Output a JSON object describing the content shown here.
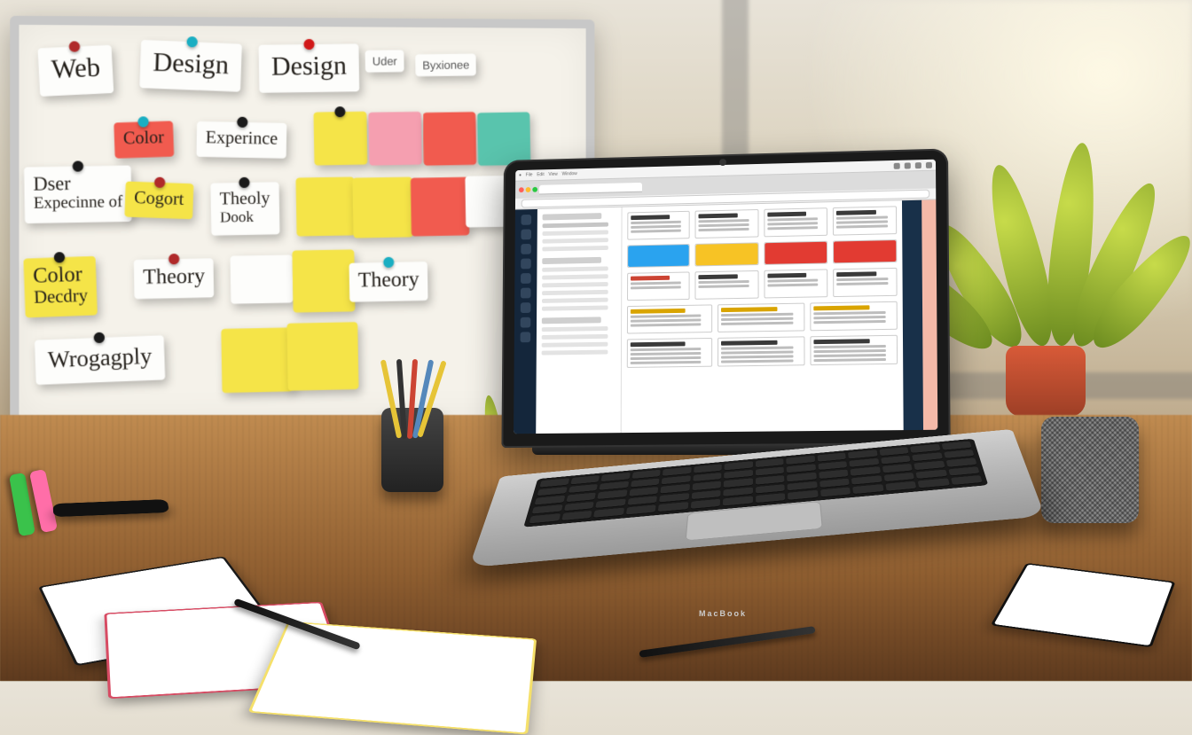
{
  "whiteboard_notes": {
    "n1": "Web",
    "n2": "Design",
    "n3": "Design",
    "n4": "Uder",
    "n5": "Byxionee",
    "n6": "Color",
    "n7": "Experince",
    "n8a": "Dser",
    "n8b": "Expecinne of",
    "n9": "Cogort",
    "n10a": "Theoly",
    "n10b": "Dook",
    "n11": "Theory",
    "n12a": "Color",
    "n12b": "Decdry",
    "n13": "Theory",
    "n14": "Wrogagply"
  },
  "laptop": {
    "brand": "MacBook",
    "ui": {
      "traffic_lights": [
        "#ff5f57",
        "#febc2e",
        "#28c840"
      ],
      "swatches": [
        "#2aa3ef",
        "#f7c325",
        "#e23b32",
        "#e23b32"
      ]
    }
  }
}
